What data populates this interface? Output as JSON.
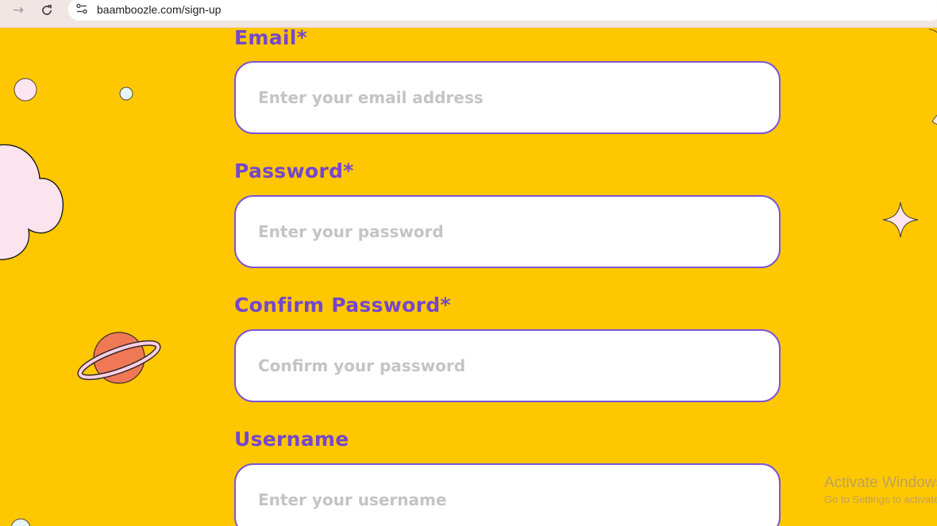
{
  "browser": {
    "url": "baamboozle.com/sign-up",
    "icons": [
      "forward-arrow-icon",
      "reload-icon",
      "site-info-icon"
    ]
  },
  "form": {
    "email": {
      "label": "Email*",
      "placeholder": "Enter your email address",
      "value": ""
    },
    "password": {
      "label": "Password*",
      "placeholder": "Enter your password",
      "value": ""
    },
    "confirm_password": {
      "label": "Confirm Password*",
      "placeholder": "Confirm your password",
      "value": ""
    },
    "username": {
      "label": "Username",
      "placeholder": "Enter your username",
      "value": ""
    }
  },
  "decorations": [
    "cloud",
    "planet",
    "sparkle-star",
    "small-dots"
  ],
  "watermark": {
    "title": "Activate Windows",
    "subtitle": "Go to Settings to activate Windows."
  },
  "colors": {
    "background": "#ffc700",
    "label": "#7447cc",
    "input_border": "#7c55d6",
    "placeholder": "#c4c4c4"
  }
}
